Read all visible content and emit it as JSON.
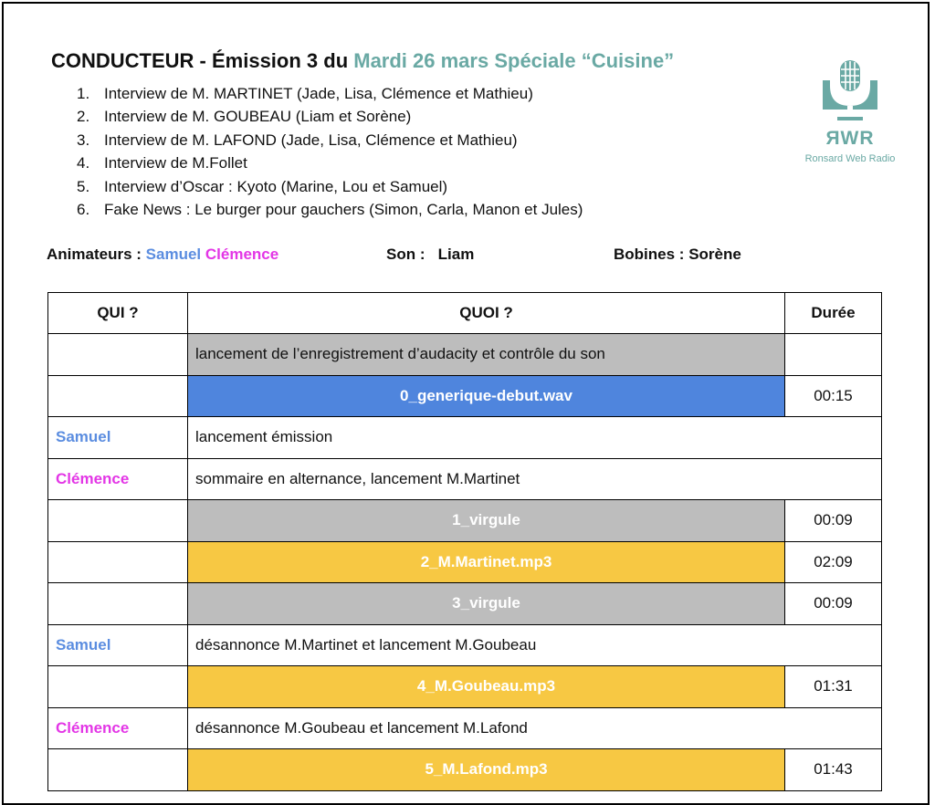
{
  "header": {
    "title_prefix": "CONDUCTEUR - Émission 3 du ",
    "title_highlight": "Mardi 26 mars Spéciale “Cuisine”"
  },
  "agenda": [
    {
      "num": "1.",
      "text": "Interview de M. MARTINET (Jade, Lisa, Clémence et Mathieu)"
    },
    {
      "num": "2.",
      "text": "Interview de M. GOUBEAU (Liam et Sorène)"
    },
    {
      "num": "3.",
      "text": "Interview de M. LAFOND (Jade, Lisa, Clémence et Mathieu)"
    },
    {
      "num": "4.",
      "text": "Interview de M.Follet"
    },
    {
      "num": "5.",
      "text": "Interview d’Oscar : Kyoto (Marine, Lou et Samuel)"
    },
    {
      "num": "6.",
      "text": "Fake News : Le burger pour gauchers (Simon, Carla, Manon et Jules)"
    }
  ],
  "logo": {
    "abbr": "ЯWR",
    "name": "Ronsard Web Radio",
    "icon": "microphone-icon",
    "color": "#6aa9a4"
  },
  "crew": {
    "hosts_label": "Animateurs :",
    "host1": "Samuel",
    "host2": "Clémence",
    "sound_label": "Son :",
    "sound": "Liam",
    "reels_label": "Bobines :",
    "reels": "Sorène"
  },
  "table": {
    "headers": {
      "who": "QUI ?",
      "what": "QUOI ?",
      "duration": "Durée"
    },
    "rows": [
      {
        "who": "",
        "what": "lancement de l’enregistrement d’audacity et contrôle du son",
        "duration": "",
        "kind": "grey-text"
      },
      {
        "who": "",
        "what": "0_generique-debut.wav",
        "duration": "00:15",
        "kind": "blue"
      },
      {
        "who": "Samuel",
        "what": "lancement émission",
        "kind": "speech"
      },
      {
        "who": "Clémence",
        "what": "sommaire en alternance, lancement M.Martinet",
        "kind": "speech"
      },
      {
        "who": "",
        "what": "1_virgule",
        "duration": "00:09",
        "kind": "grey"
      },
      {
        "who": "",
        "what": "2_M.Martinet.mp3",
        "duration": "02:09",
        "kind": "yellow"
      },
      {
        "who": "",
        "what": "3_virgule",
        "duration": "00:09",
        "kind": "grey"
      },
      {
        "who": "Samuel",
        "what": "désannonce M.Martinet et lancement M.Goubeau",
        "kind": "speech"
      },
      {
        "who": "",
        "what": "4_M.Goubeau.mp3",
        "duration": "01:31",
        "kind": "yellow"
      },
      {
        "who": "Clémence",
        "what": "désannonce M.Goubeau et lancement M.Lafond",
        "kind": "speech"
      },
      {
        "who": "",
        "what": "5_M.Lafond.mp3",
        "duration": "01:43",
        "kind": "yellow"
      }
    ]
  },
  "colors": {
    "teal": "#6aa9a4",
    "samuel": "#5b8de0",
    "clemence": "#e336e6",
    "grey": "#bdbdbd",
    "blue": "#4f85dd",
    "yellow": "#f7c843"
  }
}
